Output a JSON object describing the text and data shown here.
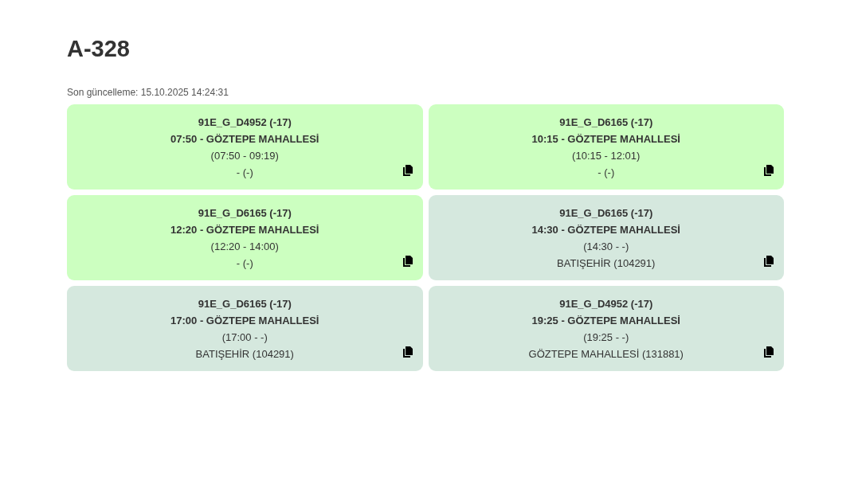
{
  "title": "A-328",
  "updated": "Son güncelleme: 15.10.2025 14:24:31",
  "cards": [
    {
      "color": "#ccffc0",
      "code": "91E_G_D4952 (-17)",
      "departure": "07:50 - GÖZTEPE MAHALLESİ",
      "times": "(07:50 - 09:19)",
      "stop": "- (-)"
    },
    {
      "color": "#ccffc0",
      "code": "91E_G_D6165 (-17)",
      "departure": "10:15 - GÖZTEPE MAHALLESİ",
      "times": "(10:15 - 12:01)",
      "stop": "- (-)"
    },
    {
      "color": "#ccffc0",
      "code": "91E_G_D6165 (-17)",
      "departure": "12:20 - GÖZTEPE MAHALLESİ",
      "times": "(12:20 - 14:00)",
      "stop": "- (-)"
    },
    {
      "color": "#d5e8de",
      "code": "91E_G_D6165 (-17)",
      "departure": "14:30 - GÖZTEPE MAHALLESİ",
      "times": "(14:30 - -)",
      "stop": "BATIŞEHİR (104291)"
    },
    {
      "color": "#d5e8de",
      "code": "91E_G_D6165 (-17)",
      "departure": "17:00 - GÖZTEPE MAHALLESİ",
      "times": "(17:00 - -)",
      "stop": "BATIŞEHİR (104291)"
    },
    {
      "color": "#d5e8de",
      "code": "91E_G_D4952 (-17)",
      "departure": "19:25 - GÖZTEPE MAHALLESİ",
      "times": "(19:25 - -)",
      "stop": "GÖZTEPE MAHALLESİ (131881)"
    }
  ]
}
